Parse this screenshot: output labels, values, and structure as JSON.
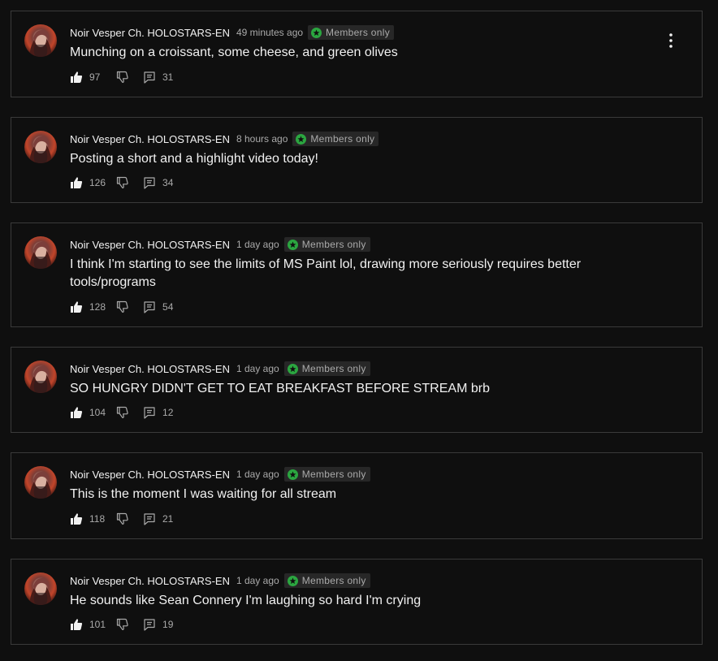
{
  "feed": {
    "posts": [
      {
        "author": "Noir Vesper Ch. HOLOSTARS-EN",
        "time": "49 minutes ago",
        "badge": "Members only",
        "text": "Munching on a croissant, some cheese, and green olives",
        "likes": "97",
        "comments": "31",
        "has_menu": true
      },
      {
        "author": "Noir Vesper Ch. HOLOSTARS-EN",
        "time": "8 hours ago",
        "badge": "Members only",
        "text": "Posting a short and a highlight video today!",
        "likes": "126",
        "comments": "34",
        "has_menu": false
      },
      {
        "author": "Noir Vesper Ch. HOLOSTARS-EN",
        "time": "1 day ago",
        "badge": "Members only",
        "text": "I think I'm starting to see the limits of MS Paint lol, drawing more seriously requires better tools/programs",
        "likes": "128",
        "comments": "54",
        "has_menu": false
      },
      {
        "author": "Noir Vesper Ch. HOLOSTARS-EN",
        "time": "1 day ago",
        "badge": "Members only",
        "text": "SO HUNGRY DIDN'T GET TO EAT BREAKFAST BEFORE STREAM brb",
        "likes": "104",
        "comments": "12",
        "has_menu": false
      },
      {
        "author": "Noir Vesper Ch. HOLOSTARS-EN",
        "time": "1 day ago",
        "badge": "Members only",
        "text": "This is the moment I was waiting for all stream",
        "likes": "118",
        "comments": "21",
        "has_menu": false
      },
      {
        "author": "Noir Vesper Ch. HOLOSTARS-EN",
        "time": "1 day ago",
        "badge": "Members only",
        "text": "He sounds like Sean Connery I'm laughing so hard I'm crying",
        "likes": "101",
        "comments": "19",
        "has_menu": false
      }
    ]
  },
  "icons": {
    "like": "thumb-up-filled-icon",
    "dislike": "thumb-down-outline-icon",
    "comment": "comment-icon",
    "menu": "more-vertical-icon",
    "badge": "membership-star-icon"
  },
  "colors": {
    "background": "#0f0f0f",
    "border": "#3a3a3a",
    "text": "#f1f1f1",
    "secondary_text": "#aaaaaa",
    "badge_bg": "#272727",
    "badge_icon": "#2ba640"
  }
}
